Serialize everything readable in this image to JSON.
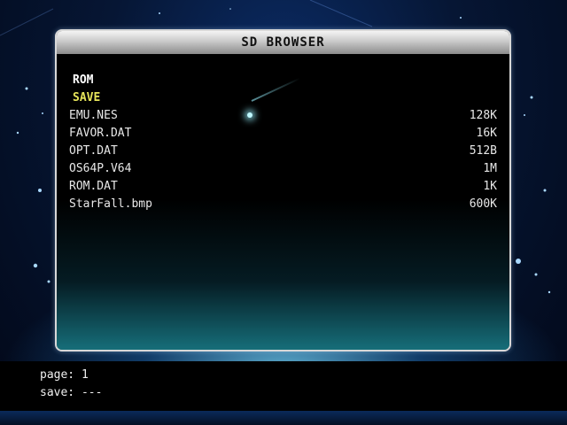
{
  "browser": {
    "title": "SD BROWSER",
    "items": [
      {
        "name": "ROM",
        "size": "",
        "type": "folder"
      },
      {
        "name": "SAVE",
        "size": "",
        "type": "folder",
        "selected": true
      },
      {
        "name": "EMU.NES",
        "size": "128K",
        "type": "file"
      },
      {
        "name": "FAVOR.DAT",
        "size": "16K",
        "type": "file"
      },
      {
        "name": "OPT.DAT",
        "size": "512B",
        "type": "file"
      },
      {
        "name": "OS64P.V64",
        "size": "1M",
        "type": "file"
      },
      {
        "name": "ROM.DAT",
        "size": "1K",
        "type": "file"
      },
      {
        "name": "StarFall.bmp",
        "size": "600K",
        "type": "file"
      }
    ]
  },
  "footer": {
    "page": "page: 1",
    "save": "save: ---"
  },
  "colors": {
    "selected": "#e6e45a",
    "text": "#e8e8e8",
    "title_bg": "#c9c9c9"
  }
}
